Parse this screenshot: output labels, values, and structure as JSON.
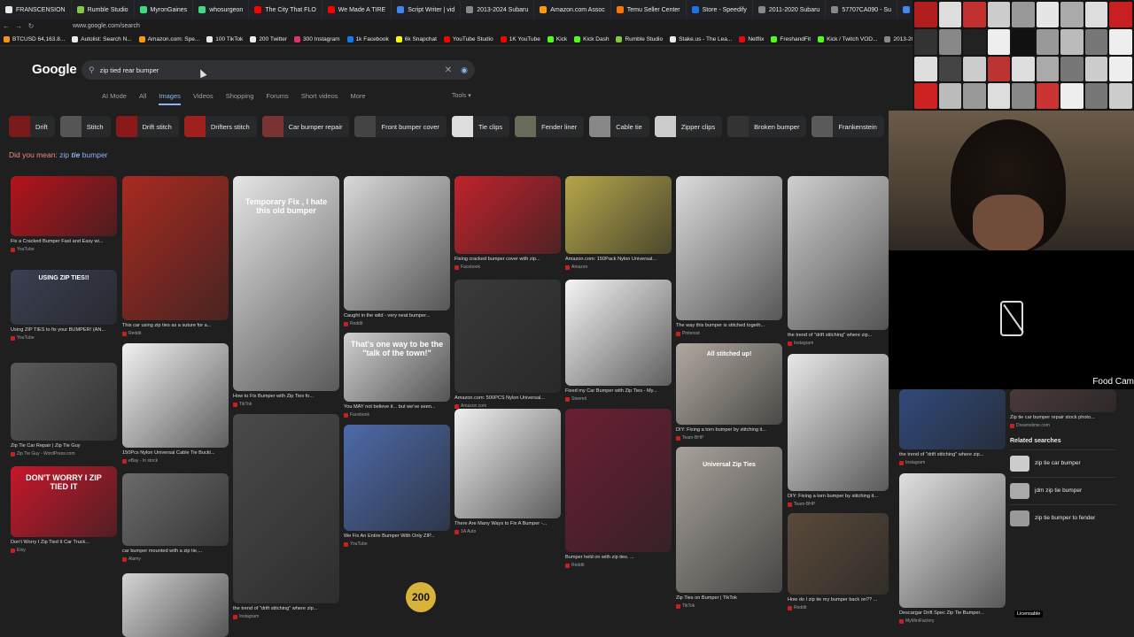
{
  "browser": {
    "tabs": [
      {
        "label": "FRANSCENSION",
        "color": "#e8eaed"
      },
      {
        "label": "Rumble Studio",
        "color": "#85c742"
      },
      {
        "label": "MyronGaines",
        "color": "#3ddc84"
      },
      {
        "label": "whosurgeon",
        "color": "#3ddc84"
      },
      {
        "label": "The City That FLO",
        "color": "#ff0000"
      },
      {
        "label": "We Made A TIRE",
        "color": "#ff0000"
      },
      {
        "label": "Script Writer | vid",
        "color": "#4285f4"
      },
      {
        "label": "2013-2024 Subaru",
        "color": "#888888"
      },
      {
        "label": "Amazon.com Assoc",
        "color": "#ff9900"
      },
      {
        "label": "Temu Seller Center",
        "color": "#fb7701"
      },
      {
        "label": "Store - Speedify",
        "color": "#1a73e8"
      },
      {
        "label": "2011-2020 Subaru",
        "color": "#888888"
      },
      {
        "label": "57707CA090 - Su",
        "color": "#888888"
      },
      {
        "label": "pepe drink - Goog",
        "color": "#4285f4"
      }
    ],
    "url": "www.google.com/search",
    "bookmarks": [
      {
        "label": "BTCUSD 64,163.8...",
        "color": "#f7931a"
      },
      {
        "label": "Autolist: Search N...",
        "color": "#e8eaed"
      },
      {
        "label": "Amazon.com: Spe...",
        "color": "#ff9900"
      },
      {
        "label": "100 TikTok",
        "color": "#e8eaed"
      },
      {
        "label": "200 Twitter",
        "color": "#e8eaed"
      },
      {
        "label": "300 Instagram",
        "color": "#e1306c"
      },
      {
        "label": "1k Facebook",
        "color": "#1877f2"
      },
      {
        "label": "6k Snapchat",
        "color": "#fffc00"
      },
      {
        "label": "YouTube Studio",
        "color": "#ff0000"
      },
      {
        "label": "1K YouTube",
        "color": "#ff0000"
      },
      {
        "label": "Kick",
        "color": "#53fc18"
      },
      {
        "label": "Kick Dash",
        "color": "#53fc18"
      },
      {
        "label": "Rumble Studio",
        "color": "#85c742"
      },
      {
        "label": "Stake.us - The Lea...",
        "color": "#e8eaed"
      },
      {
        "label": "Netflix",
        "color": "#e50914"
      },
      {
        "label": "FreshandFit",
        "color": "#53fc18"
      },
      {
        "label": "Kick / Twitch VOD...",
        "color": "#53fc18"
      },
      {
        "label": "2013-20",
        "color": "#888888"
      }
    ]
  },
  "google": {
    "logo": "Google",
    "query": "zip tied rear bumper",
    "tabs": [
      "AI Mode",
      "All",
      "Images",
      "Videos",
      "Shopping",
      "Forums",
      "Short videos",
      "More"
    ],
    "active_tab": "Images",
    "tools": "Tools",
    "chips": [
      "Drift",
      "Stitch",
      "Drift stitch",
      "Drifters stitch",
      "Car bumper repair",
      "Front bumper cover",
      "Tie clips",
      "Fender liner",
      "Cable tie",
      "Zipper clips",
      "Broken bumper",
      "Frankenstein"
    ],
    "did_you_mean": {
      "prefix": "Did you mean: ",
      "word1": "zip ",
      "word2": "tie",
      "word3": " bumper"
    }
  },
  "results": [
    {
      "cap": "Fix a Cracked Bumper Fast and Easy wi...",
      "src": "YouTube"
    },
    {
      "cap": "Using ZIP TIES to fix your BUMPER! (AN...",
      "src": "YouTube",
      "overlay": "USING ZIP TIES!!"
    },
    {
      "cap": "Zip Tie Car Repair | Zip Tie Guy",
      "src": "Zip Tie Guy - WordPress.com"
    },
    {
      "cap": "Don't Worry I Zip Tied It Car Truck...",
      "src": "Etsy",
      "overlay": "DON'T WORRY I ZIP TIED IT"
    },
    {
      "cap": "This car using zip ties as a suture for a...",
      "src": "Reddit"
    },
    {
      "cap": "150Pcs Nylon Universal Cable Tie Buckl...",
      "src": "eBay - In stock"
    },
    {
      "cap": "car bumper mounted with a zip tie,...",
      "src": "Alamy"
    },
    {
      "cap": "How do I zip tie my bumper back on?? ...",
      "src": "Reddit"
    },
    {
      "cap": "How to Fix Bumper with Zip Ties fo...",
      "src": "TikTok",
      "overlay": "Temporary Fix , I hate this old bumper"
    },
    {
      "cap": "the trend of \"drift stitching\" where zip...",
      "src": "Instagram"
    },
    {
      "cap": "Caught in the wild - very neat bumper...",
      "src": "Reddit"
    },
    {
      "cap": "You MAY not believe it... but we've seen...",
      "src": "Facebook",
      "overlay": "That's one way to be the \"talk of the town!\""
    },
    {
      "cap": "We Fix An Entire Bumper With Only ZIP...",
      "src": "YouTube"
    },
    {
      "cap": "Fixing cracked bumper cover with zip...",
      "src": "Facebook"
    },
    {
      "cap": "Amazon.com: 500PCS Nylon Universal...",
      "src": "Amazon.com"
    },
    {
      "cap": "There Are Many Ways to Fix A Bumper -...",
      "src": "1A Auto"
    },
    {
      "cap": "Amazon.com: 150Pack Nylon Universal...",
      "src": "Amazon"
    },
    {
      "cap": "Fixed my Car Bumper with Zip Ties - My...",
      "src": "Steemit"
    },
    {
      "cap": "Bumper held on with zip ties. ...",
      "src": "Reddit"
    },
    {
      "cap": "The way this bumper is stitched togeth...",
      "src": "Pinterest"
    },
    {
      "cap": "DIY: Fixing a torn bumper by stitching it...",
      "src": "Team-BHP",
      "overlay": "All stitched up!"
    },
    {
      "cap": "Zip Ties on Bumper | TikTok",
      "src": "TikTok",
      "overlay": "Universal Zip Ties"
    },
    {
      "cap": "the trend of \"drift stitching\" where zip...",
      "src": "Instagram"
    },
    {
      "cap": "DIY: Fixing a torn bumper by stitching it...",
      "src": "Team-BHP"
    },
    {
      "cap": "How do I zip tie my bumper back on?? ...",
      "src": "Reddit"
    },
    {
      "cap": "the trend of \"drift stitching\" where zip...",
      "src": "Instagram"
    },
    {
      "cap": "Descargar Drift Spec Zip Tie Bumper...",
      "src": "MyMiniFactory"
    },
    {
      "cap": "Zip tie car bumper repair stock photo...",
      "src": "Dreamstime.com"
    }
  ],
  "amazon_overlay": "200",
  "licensable": "Licensable",
  "related": {
    "heading": "Related searches",
    "items": [
      "zip tie car bumper",
      "jdm zip tie bumper",
      "zip tie bumper to fender"
    ]
  },
  "webcam": {
    "label": "Food Cam"
  }
}
